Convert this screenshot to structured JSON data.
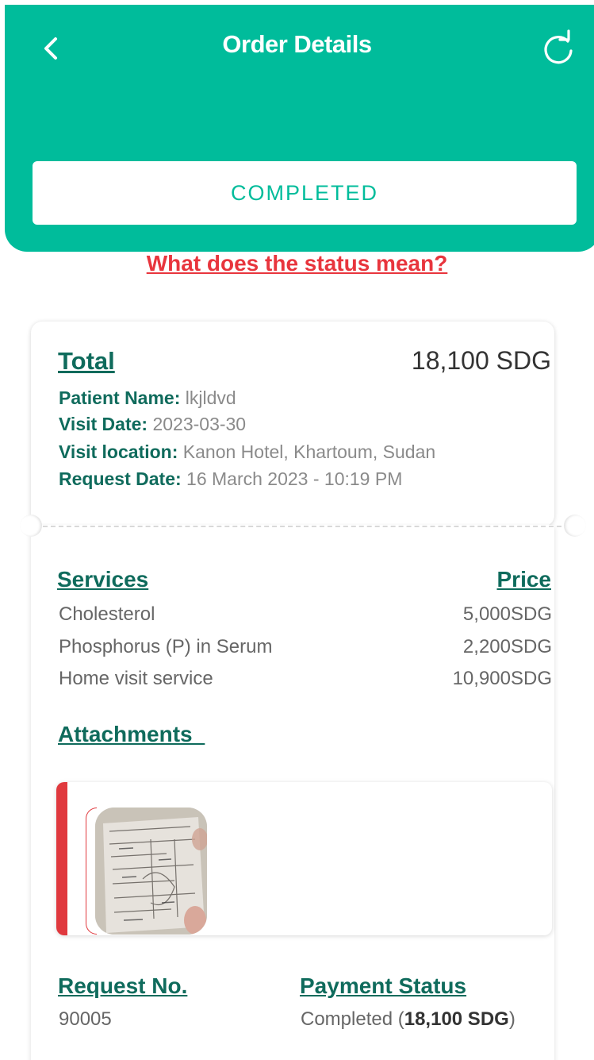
{
  "header": {
    "title": "Order Details",
    "back_icon": "chevron-left-icon",
    "refresh_icon": "refresh-icon",
    "background": "#00bc9b"
  },
  "status": {
    "label": "COMPLETED",
    "help_link": "What does the status mean?"
  },
  "summary": {
    "total_label": "Total",
    "total_value": "18,100 SDG",
    "fields": [
      {
        "key": "Patient Name:",
        "value": "lkjldvd"
      },
      {
        "key": "Visit Date:",
        "value": "2023-03-30"
      },
      {
        "key": "Visit location:",
        "value": "Kanon Hotel, Khartoum, Sudan"
      },
      {
        "key": "Request Date:",
        "value": "16 March 2023 - 10:19 PM"
      }
    ]
  },
  "services": {
    "header_label": "Services",
    "price_label": "Price",
    "items": [
      {
        "name": "Cholesterol",
        "price": "5,000SDG"
      },
      {
        "name": "Phosphorus (P) in Serum",
        "price": "2,200SDG"
      },
      {
        "name": "Home visit service",
        "price": "10,900SDG"
      }
    ]
  },
  "attachments": {
    "label": "Attachments_",
    "items": [
      {
        "icon": "document-photo-thumbnail"
      }
    ],
    "accent": "#e0393e"
  },
  "request": {
    "label": "Request No.",
    "value": "90005"
  },
  "payment": {
    "label": "Payment Status",
    "status": "Completed (",
    "amount": "18,100 SDG",
    "close": ")"
  }
}
